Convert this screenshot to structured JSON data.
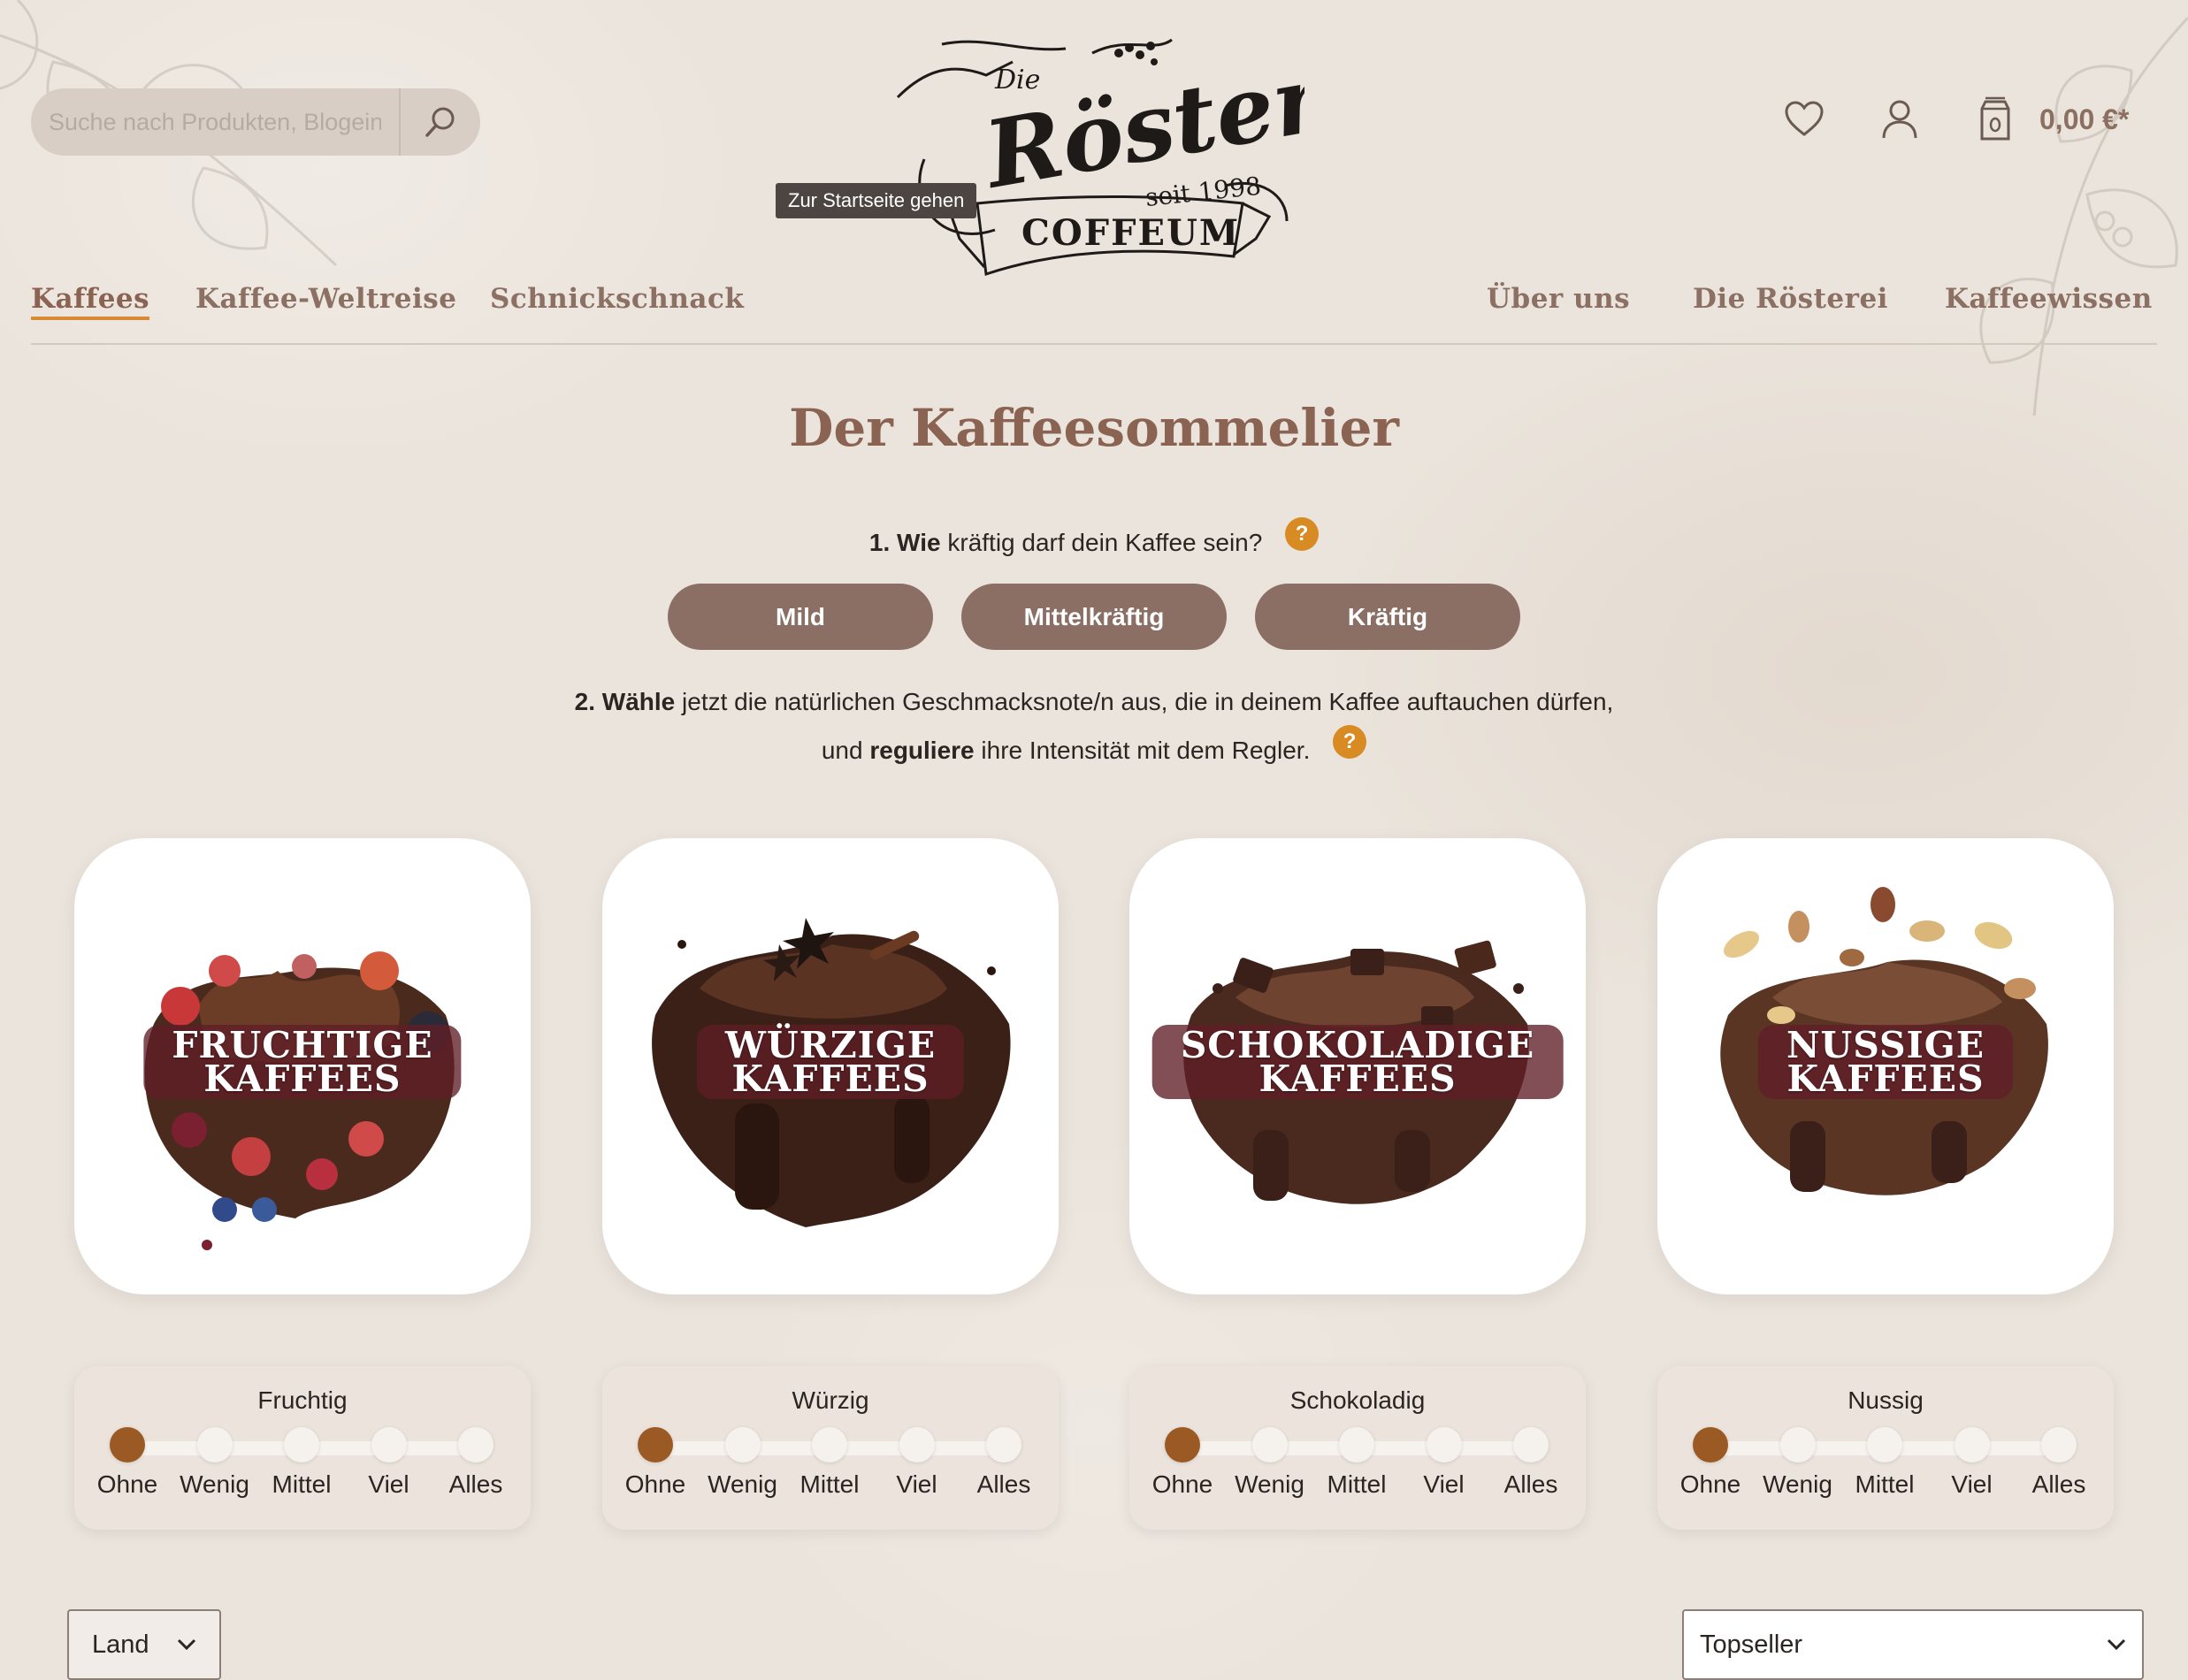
{
  "search": {
    "placeholder": "Suche nach Produkten, Blogeinträgen..."
  },
  "logo": {
    "die": "Die",
    "name": "Rösterei",
    "since": "seit 1998",
    "brand": "COFFEUM",
    "tooltip": "Zur Startseite gehen"
  },
  "header": {
    "cart_total": "0,00 €*"
  },
  "nav": {
    "left": [
      "Kaffees",
      "Kaffee-Weltreise",
      "Schnickschnack"
    ],
    "right": [
      "Über uns",
      "Die Rösterei",
      "Kaffeewissen"
    ]
  },
  "page": {
    "title": "Der Kaffeesommelier",
    "q1_num": "1.",
    "q1_bold": "Wie",
    "q1_rest": "kräftig darf dein Kaffee sein?",
    "help": "?",
    "strength_options": [
      "Mild",
      "Mittelkräftig",
      "Kräftig"
    ],
    "q2_bold": "2. Wähle",
    "q2_rest": "jetzt die natürlichen Geschmacksnote/n aus, die in deinem Kaffee auftauchen dürfen,",
    "q2_line2_pre": "und",
    "q2_line2_bold": "reguliere",
    "q2_line2_rest": "ihre Intensität mit dem Regler."
  },
  "cards": [
    {
      "label": "FRUCHTIGE\nKAFFEES",
      "slider_title": "Fruchtig",
      "level": 0
    },
    {
      "label": "WÜRZIGE\nKAFFEES",
      "slider_title": "Würzig",
      "level": 0
    },
    {
      "label": "SCHOKOLADIGE\nKAFFEES",
      "slider_title": "Schokoladig",
      "level": 0
    },
    {
      "label": "NUSSIGE\nKAFFEES",
      "slider_title": "Nussig",
      "level": 0
    }
  ],
  "slider_levels": [
    "Ohne",
    "Wenig",
    "Mittel",
    "Viel",
    "Alles"
  ],
  "filters": {
    "country": "Land",
    "sort": "Topseller"
  },
  "colors": {
    "accent": "#d88a23",
    "brown_button": "#8b6f65",
    "heading": "#8b6353",
    "slider_active": "#9b5a24",
    "label_overlay": "#601e26"
  }
}
